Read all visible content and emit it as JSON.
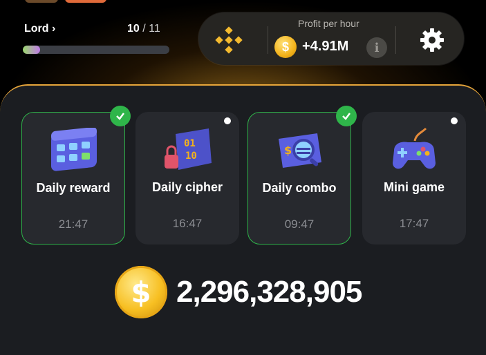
{
  "header": {
    "rank_label": "Lord",
    "rank_chevron": "›",
    "level_current": "10",
    "level_total": "/ 11",
    "level_progress": 0.12
  },
  "profit": {
    "exchange_icon": "binance-logo-icon",
    "label": "Profit per hour",
    "value": "+4.91M",
    "coin_symbol": "$",
    "info_symbol": "i",
    "settings_icon": "gear-icon"
  },
  "tasks": [
    {
      "title": "Daily reward",
      "time": "21:47",
      "completed": true,
      "icon": "calendar-icon"
    },
    {
      "title": "Daily cipher",
      "time": "16:47",
      "completed": false,
      "icon": "cipher-lock-icon"
    },
    {
      "title": "Daily combo",
      "time": "09:47",
      "completed": true,
      "icon": "combo-card-icon"
    },
    {
      "title": "Mini game",
      "time": "17:47",
      "completed": false,
      "icon": "gamepad-icon"
    }
  ],
  "balance": {
    "coin_symbol": "$",
    "value": "2,296,328,905"
  },
  "colors": {
    "accent_gold": "#f3b21a",
    "success_green": "#2fb54a",
    "panel_bg": "#1b1d21",
    "card_bg": "#27292e"
  }
}
